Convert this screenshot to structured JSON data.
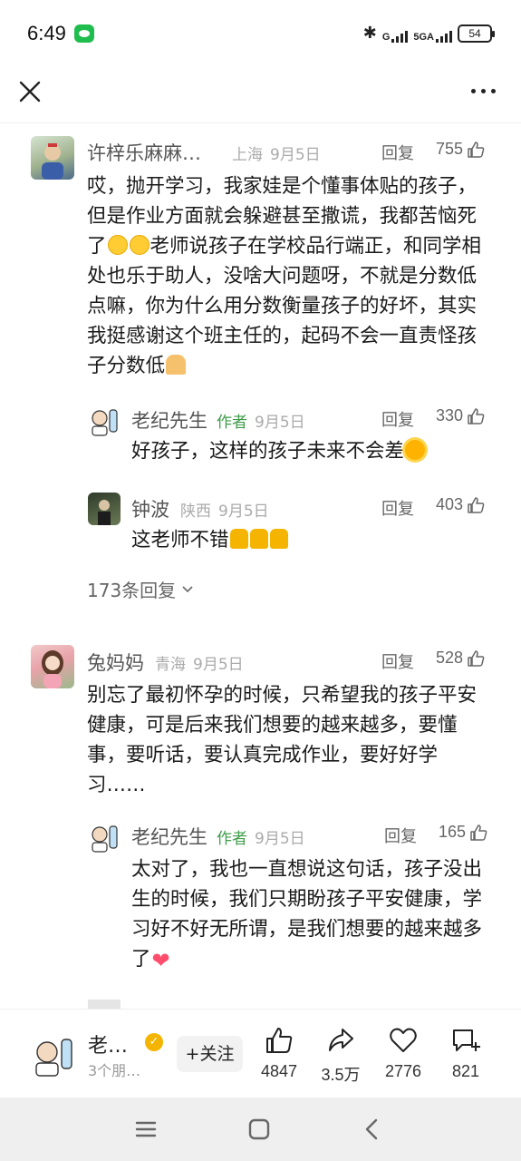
{
  "status": {
    "time": "6:49",
    "signal1": "G",
    "signal2": "5GA",
    "battery": "54"
  },
  "comments": [
    {
      "name": "许梓乐麻麻…",
      "location": "上海",
      "date": "9月5日",
      "reply": "回复",
      "likes": "755",
      "text_1": "哎，抛开学习，我家娃是个懂事体贴的孩子，但是作业方面就会躲避甚至撒谎，我都苦恼死了",
      "text_2": "老师说孩子在学校品行端正，和同学相处也乐于助人，没啥大问题呀，不就是分数低点嘛，你为什么用分数衡量孩子的好坏，其实我挺感谢这个班主任的，起码不会一直责怪孩子分数低",
      "replies": [
        {
          "name": "老纪先生",
          "tag": "作者",
          "date": "9月5日",
          "reply": "回复",
          "likes": "330",
          "text": "好孩子，这样的孩子未来不会差"
        },
        {
          "name": "钟波",
          "location": "陕西",
          "date": "9月5日",
          "reply": "回复",
          "likes": "403",
          "text": "这老师不错"
        }
      ],
      "more_replies": "173条回复"
    },
    {
      "name": "兔妈妈",
      "location": "青海",
      "date": "9月5日",
      "reply": "回复",
      "likes": "528",
      "text": "别忘了最初怀孕的时候，只希望我的孩子平安健康，可是后来我们想要的越来越多，要懂事，要听话，要认真完成作业，要好好学习……",
      "replies": [
        {
          "name": "老纪先生",
          "tag": "作者",
          "date": "9月5日",
          "reply": "回复",
          "likes": "165",
          "text": "太对了，我也一直想说这句话，孩子没出生的时候，我们只期盼孩子平安健康，学习好不好无所谓，是我们想要的越来越多了"
        }
      ]
    }
  ],
  "bottom": {
    "author_name": "老…",
    "author_sub": "3个朋…",
    "follow": "+关注",
    "likes": "4847",
    "shares": "3.5万",
    "favorites": "2776",
    "comments": "821"
  },
  "colors": {
    "author_tag": "#3f9d4a",
    "verified": "#f5b400",
    "heart": "#ff4d6d"
  }
}
